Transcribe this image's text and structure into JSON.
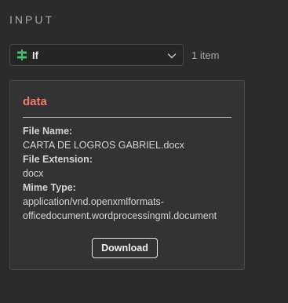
{
  "panel": {
    "title": "INPUT"
  },
  "node_select": {
    "label": "If",
    "icon": "if-node-icon",
    "icon_color": "#3fc26b"
  },
  "item_count": "1 item",
  "card": {
    "title": "data",
    "title_color": "#f27b6b",
    "fields": [
      {
        "key": "File Name:",
        "value": "CARTA DE LOGROS GABRIEL.docx"
      },
      {
        "key": "File Extension:",
        "value": "docx"
      },
      {
        "key": "Mime Type:",
        "value": "application/vnd.openxmlformats-officedocument.wordprocessingml.document"
      }
    ],
    "download_label": "Download"
  }
}
